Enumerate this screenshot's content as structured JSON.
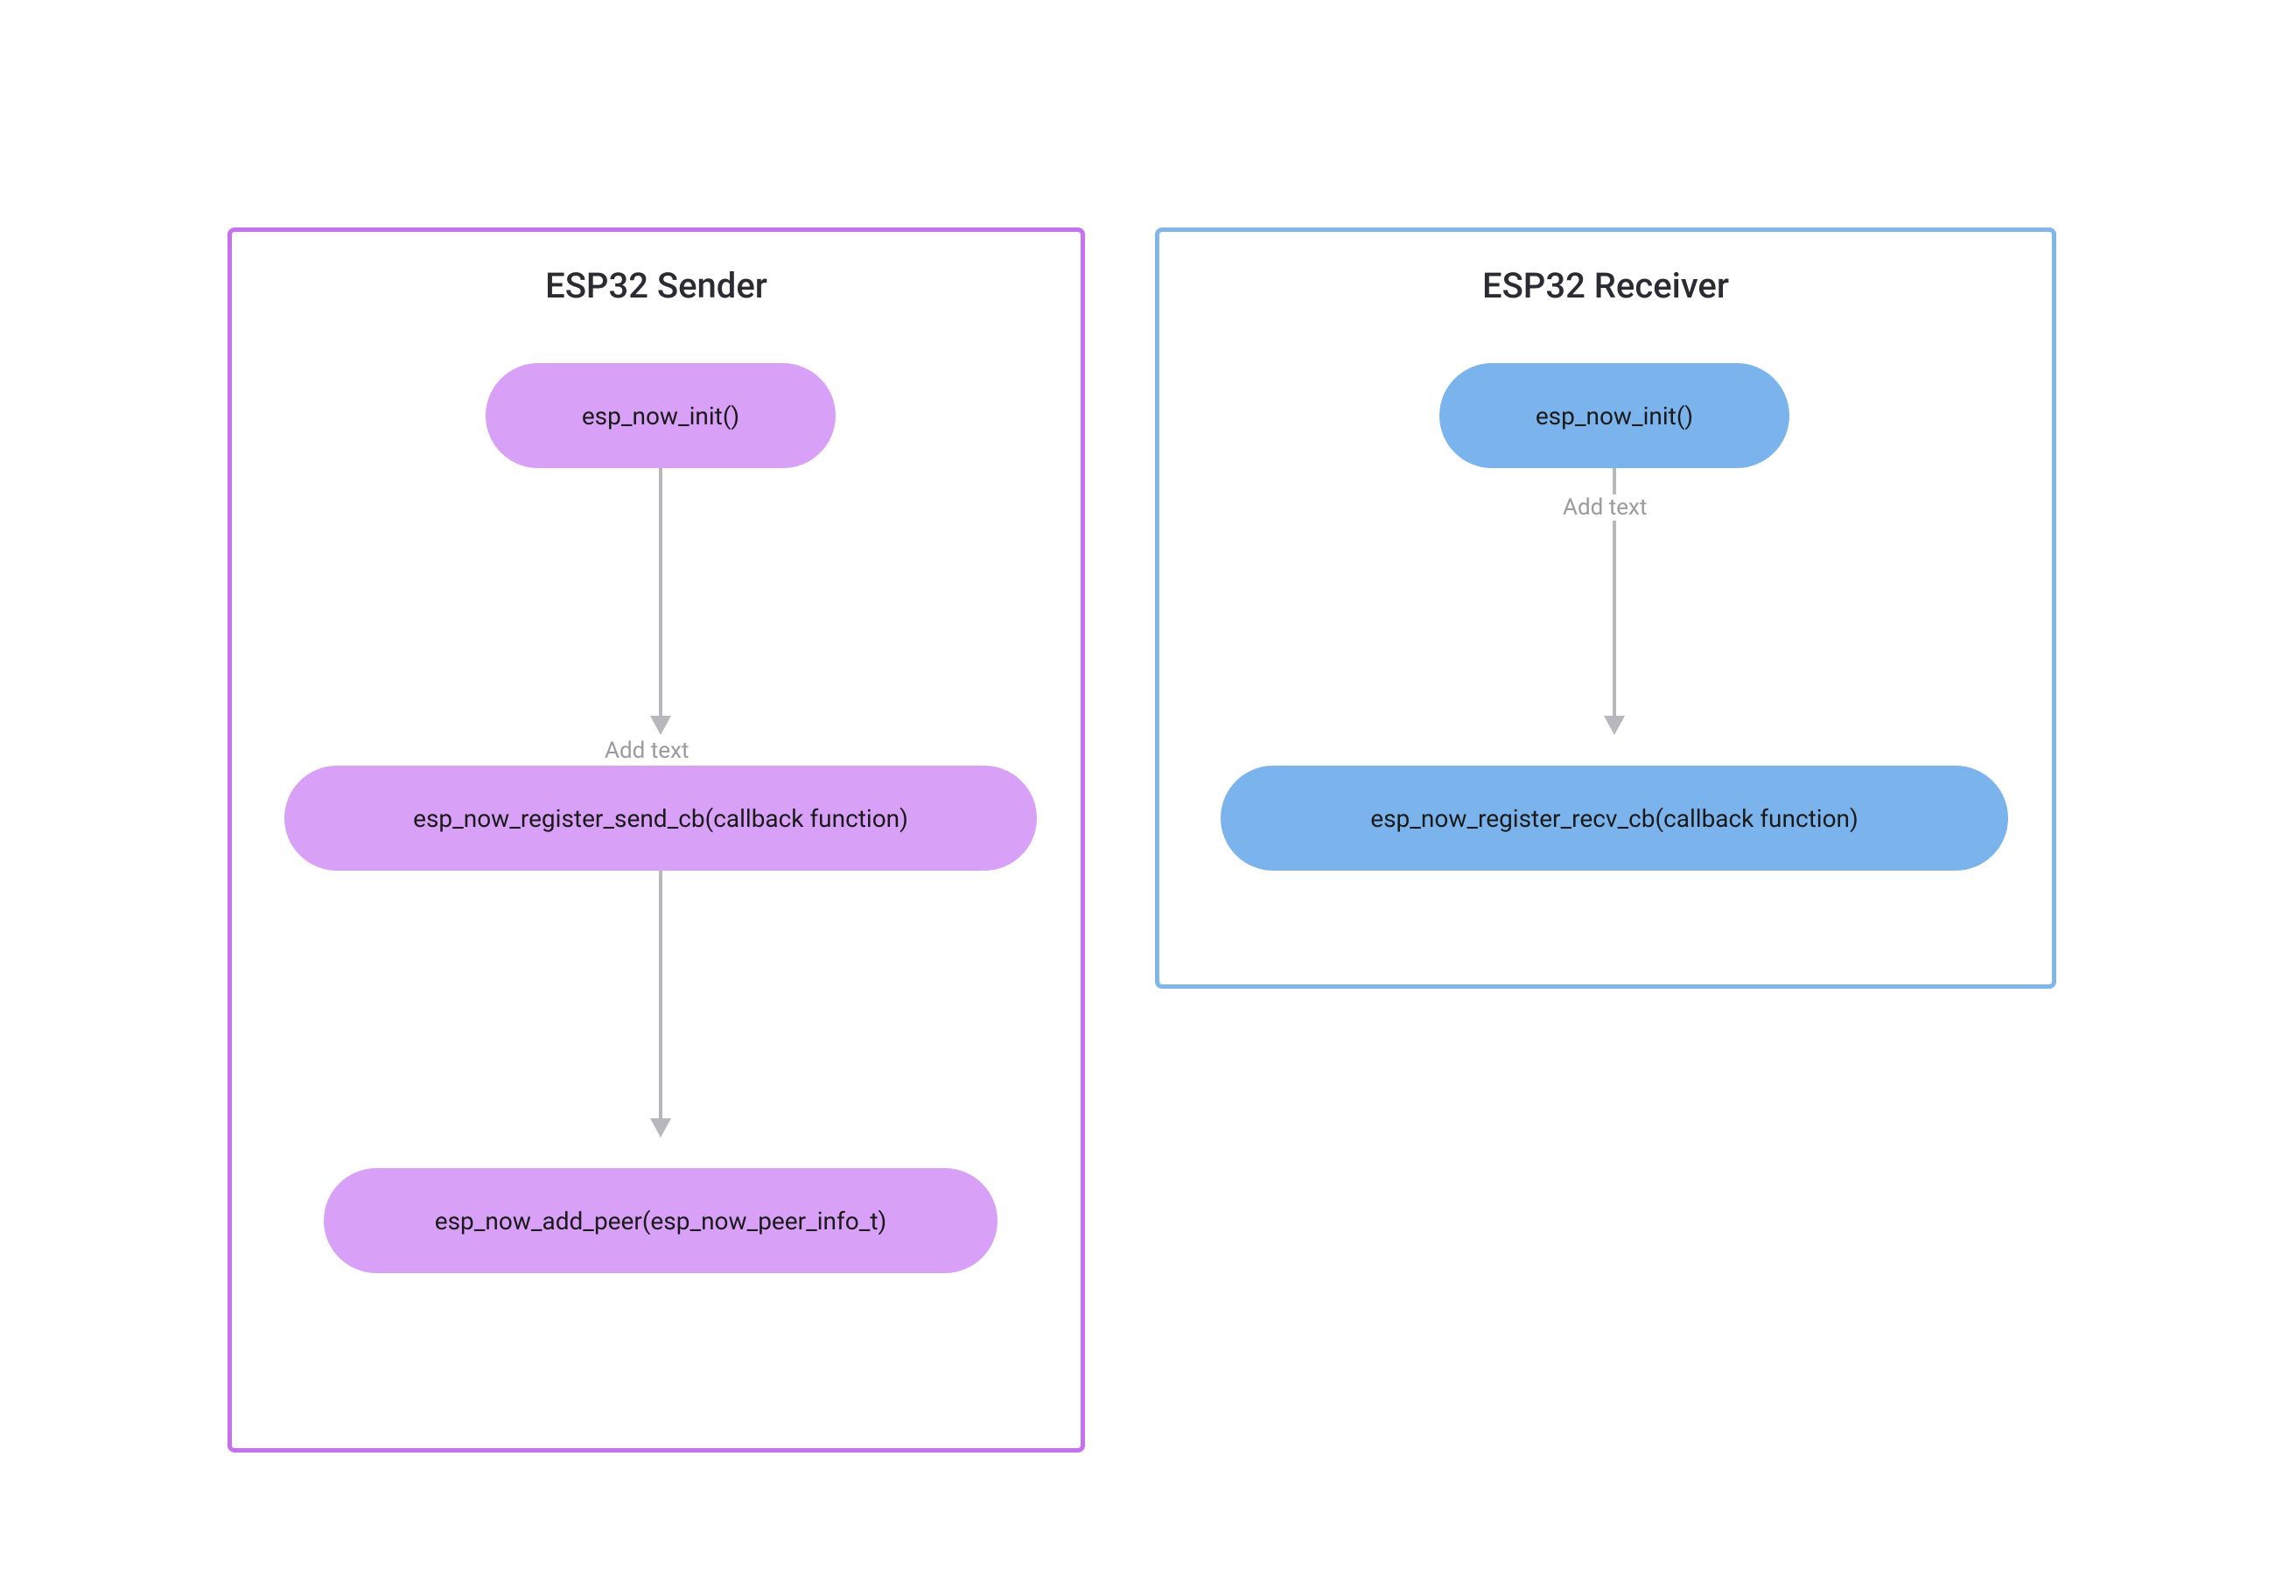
{
  "colors": {
    "sender_border": "#c770f0",
    "sender_node": "#d8a0f7",
    "receiver_border": "#7fb6ee",
    "receiver_node": "#7bb4ed",
    "arrow": "#b7b7bd",
    "label_gray": "#9a9aa0",
    "text_dark": "#2b2b33"
  },
  "sender": {
    "title": "ESP32 Sender",
    "nodes": [
      {
        "label": "esp_now_init()"
      },
      {
        "label": "esp_now_register_send_cb(callback function)"
      },
      {
        "label": "esp_now_add_peer(esp_now_peer_info_t)"
      }
    ],
    "arrow_labels": [
      "Add text",
      ""
    ]
  },
  "receiver": {
    "title": "ESP32 Receiver",
    "nodes": [
      {
        "label": "esp_now_init()"
      },
      {
        "label": "esp_now_register_recv_cb(callback function)"
      }
    ],
    "arrow_labels": [
      "Add text"
    ]
  }
}
